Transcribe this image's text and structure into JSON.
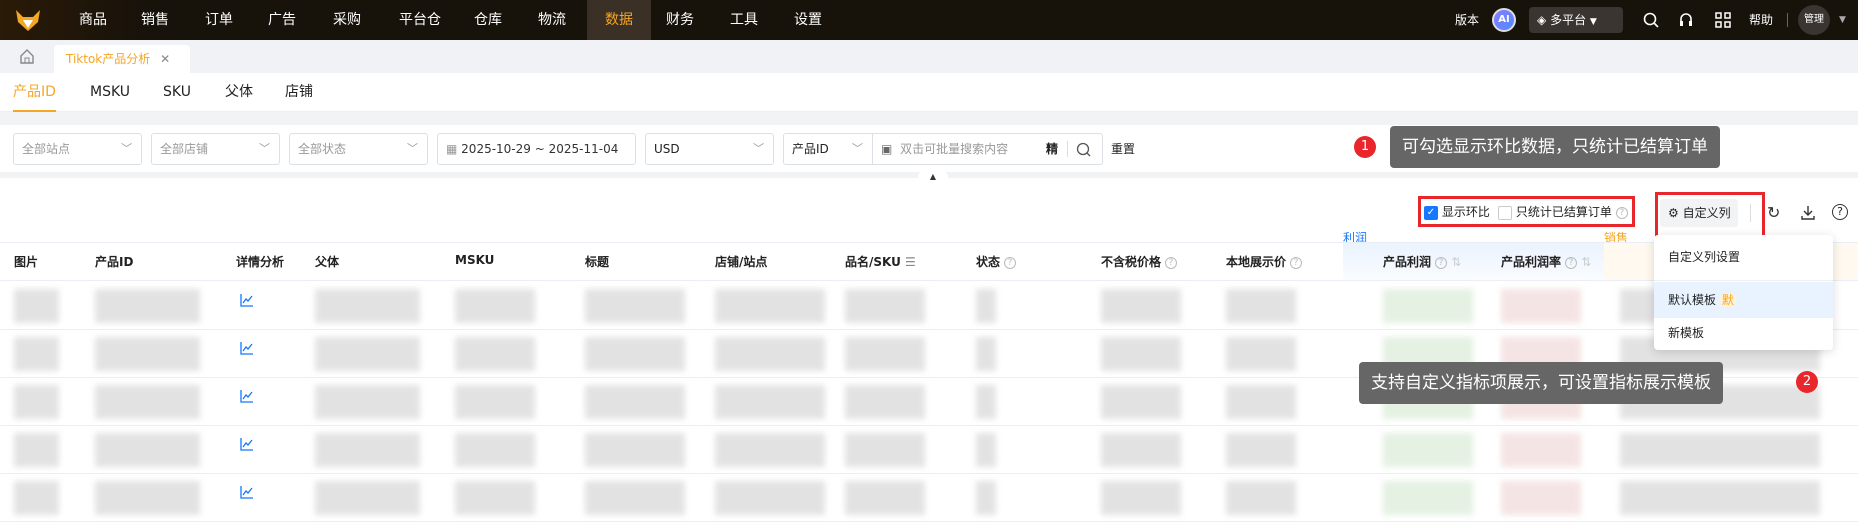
{
  "topnav": {
    "items": [
      "商品",
      "销售",
      "订单",
      "广告",
      "采购",
      "平台仓",
      "仓库",
      "物流",
      "数据",
      "财务",
      "工具",
      "设置"
    ],
    "active": "数据",
    "right": {
      "version": "版本",
      "ai": "AI",
      "platform": "多平台",
      "help": "帮助",
      "user": "管理"
    }
  },
  "tabs": [
    {
      "label": "Tiktok产品分析"
    }
  ],
  "subtabs": [
    "产品ID",
    "MSKU",
    "SKU",
    "父体",
    "店铺"
  ],
  "filters": {
    "site": "全部站点",
    "shop": "全部店铺",
    "status": "全部状态",
    "date_range": "2025-10-29 ~ 2025-11-04",
    "currency": "USD",
    "search_type": "产品ID",
    "search_placeholder": "双击可批量搜索内容",
    "precise": "精",
    "reset": "重置"
  },
  "toolbar": {
    "show_compare": "显示环比",
    "show_compare_checked": true,
    "settled_only": "只统计已结算订单",
    "settled_only_checked": false,
    "custom_columns": "自定义列"
  },
  "dropdown": {
    "settings": "自定义列设置",
    "default_template": "默认模板",
    "default_badge": "默",
    "new_template": "新模板"
  },
  "groups": {
    "profit": "利润",
    "sales": "销售"
  },
  "columns": [
    "图片",
    "产品ID",
    "详情分析",
    "父体",
    "MSKU",
    "标题",
    "店铺/站点",
    "品名/SKU",
    "状态",
    "不含税价格",
    "本地展示价",
    "产品利润",
    "产品利润率"
  ],
  "tooltips": {
    "one": "可勾选显示环比数据，只统计已结算订单",
    "one_num": "1",
    "two": "支持自定义指标项展示，可设置指标展示模板",
    "two_num": "2"
  },
  "colors": {
    "accent": "#f5a623",
    "primary": "#1677ff",
    "annotation": "#e8262b"
  }
}
